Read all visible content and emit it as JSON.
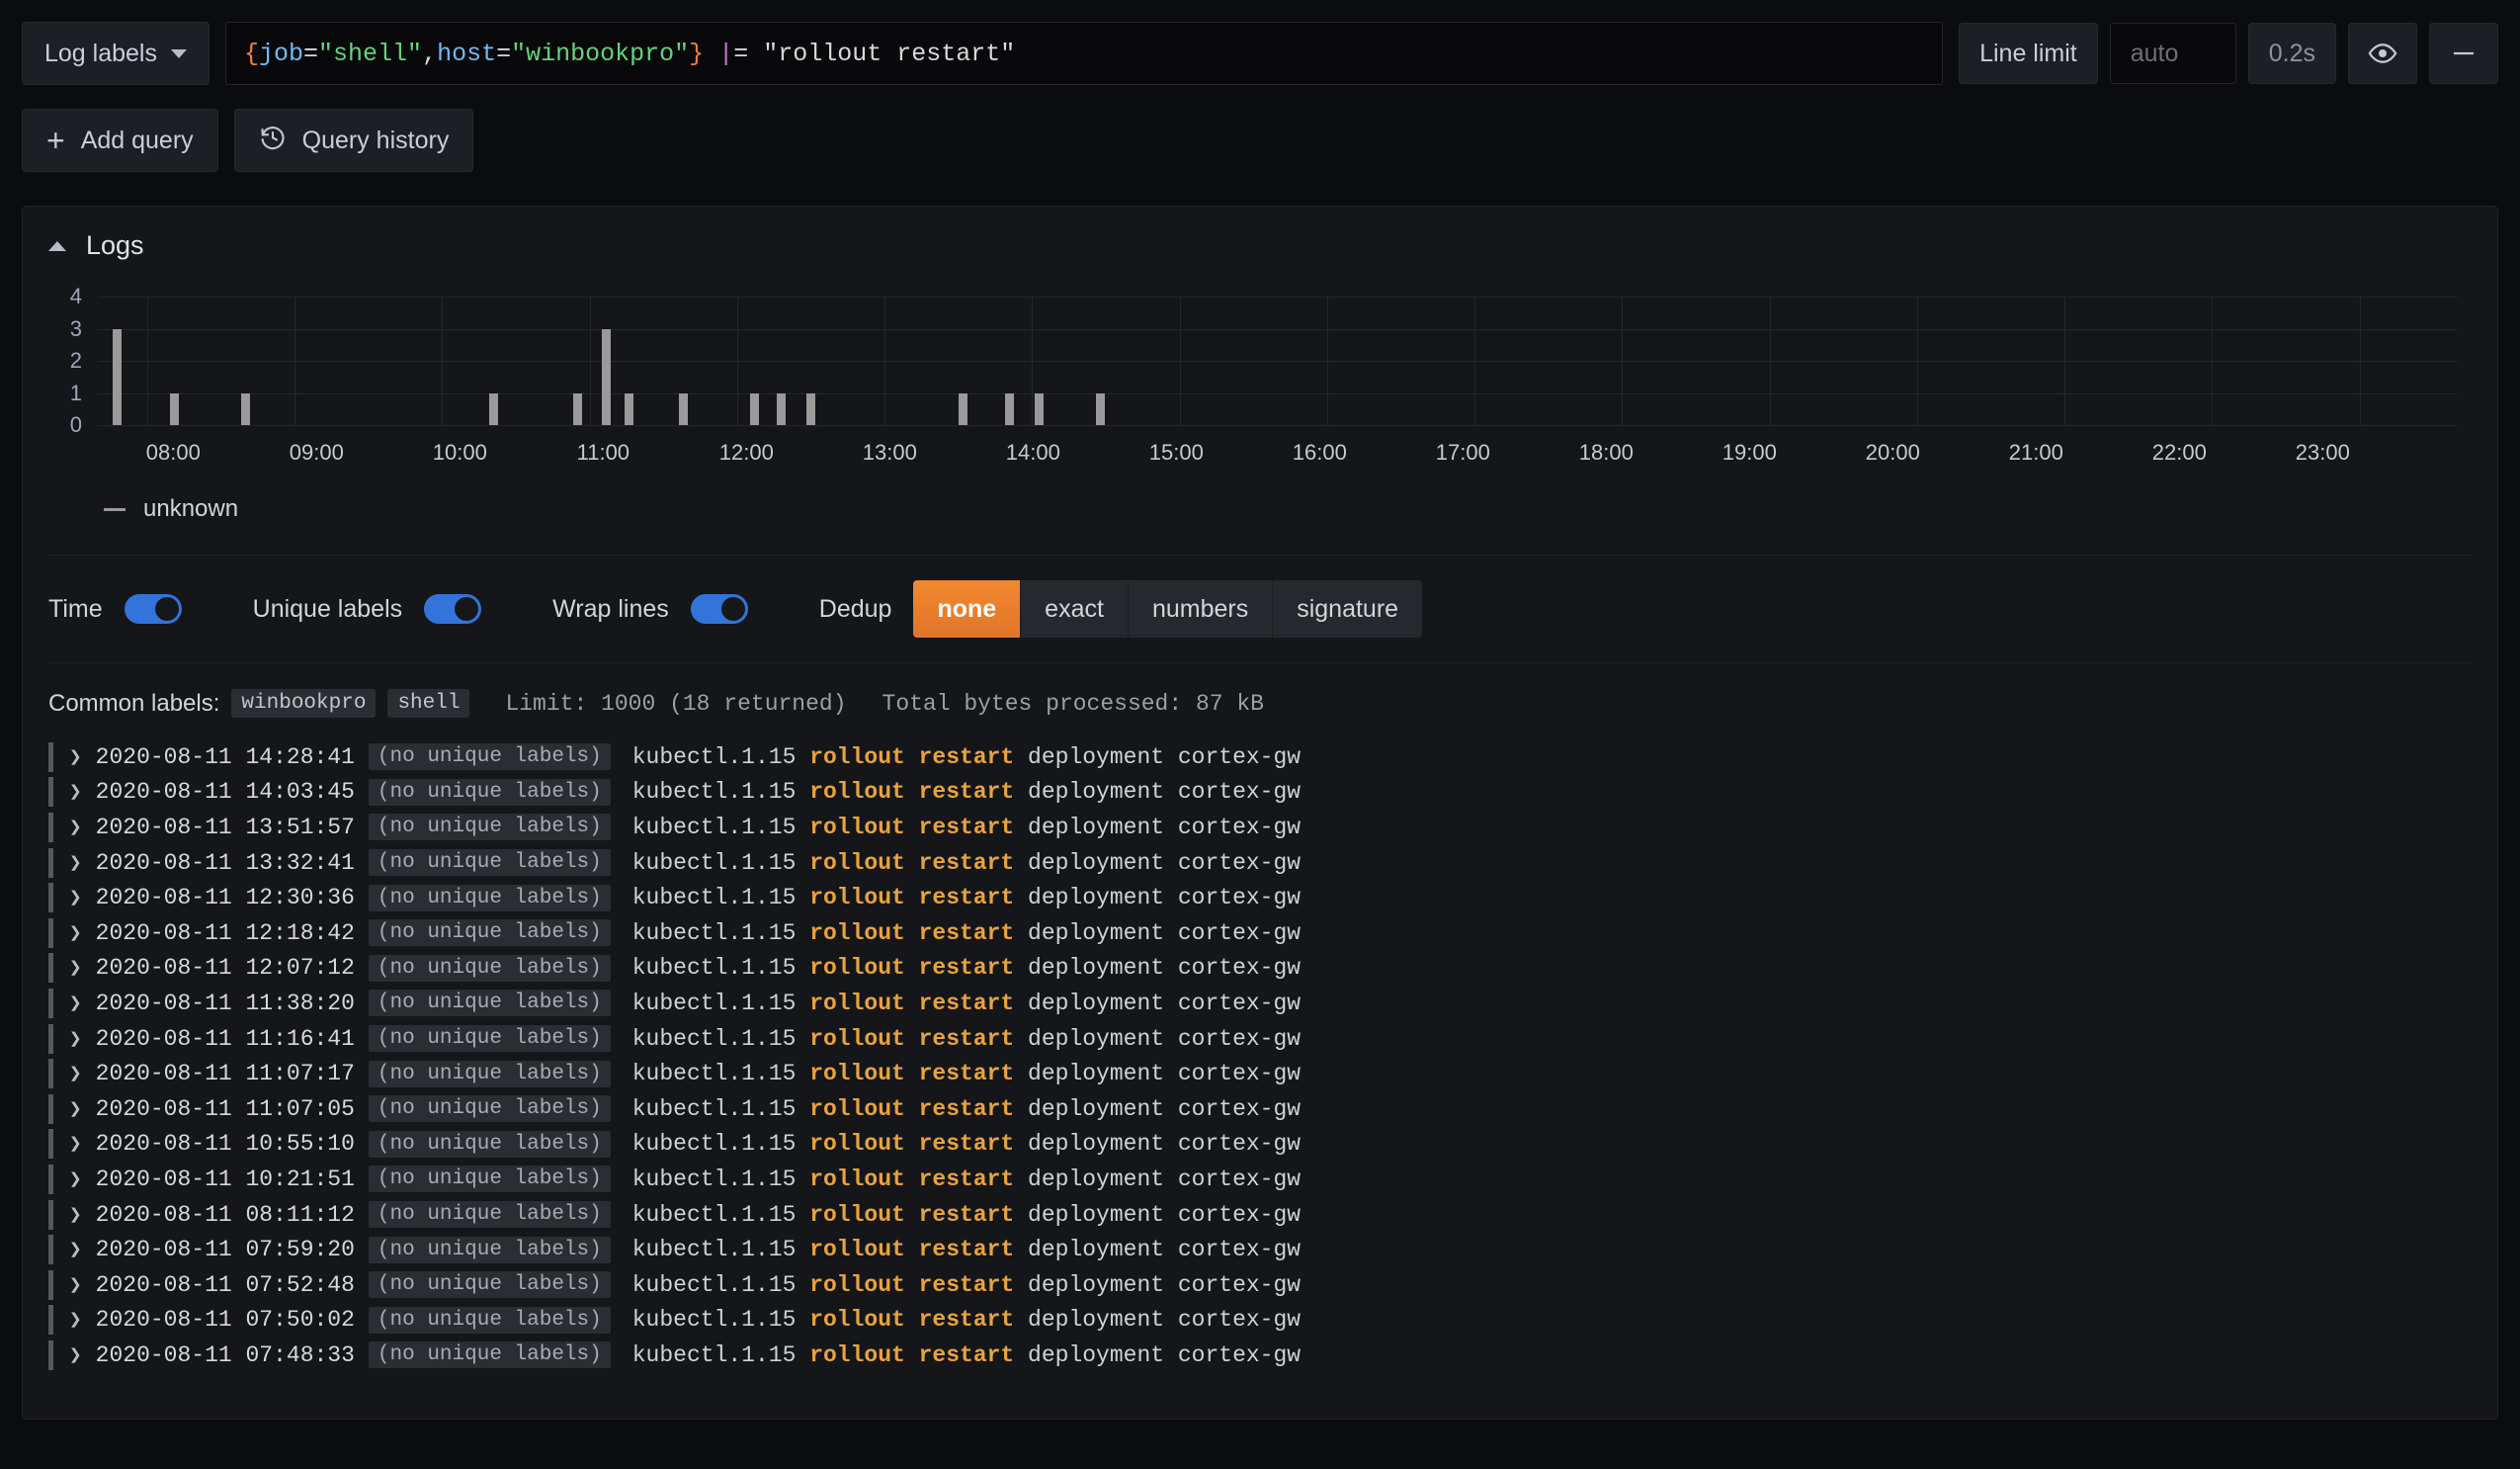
{
  "query": {
    "log_labels_button": "Log labels",
    "expr_tokens": [
      {
        "t": "{",
        "c": "brace"
      },
      {
        "t": "job",
        "c": "label"
      },
      {
        "t": "=",
        "c": "eq"
      },
      {
        "t": "\"shell\"",
        "c": "str"
      },
      {
        "t": ",",
        "c": "eq"
      },
      {
        "t": "host",
        "c": "label"
      },
      {
        "t": "=",
        "c": "eq"
      },
      {
        "t": "\"winbookpro\"",
        "c": "str"
      },
      {
        "t": "}",
        "c": "brace"
      },
      {
        "t": " ",
        "c": "plain"
      },
      {
        "t": "|",
        "c": "pipe"
      },
      {
        "t": "= ",
        "c": "plain"
      },
      {
        "t": "\"rollout restart\"",
        "c": "plain"
      }
    ],
    "expr_plain": "{job=\"shell\",host=\"winbookpro\"} |= \"rollout restart\"",
    "line_limit_label": "Line limit",
    "line_limit_placeholder": "auto",
    "line_limit_value": "",
    "duration": "0.2s",
    "eye_icon": "eye-icon",
    "remove_icon": "minus-icon"
  },
  "actions": {
    "add_query": "Add query",
    "query_history": "Query history",
    "add_icon": "plus-icon",
    "history_icon": "history-icon"
  },
  "panel": {
    "title": "Logs",
    "collapse_icon": "chevron-up-icon"
  },
  "chart_data": {
    "type": "bar",
    "title": "Logs",
    "xlabel": "",
    "ylabel": "",
    "ylim": [
      0,
      4
    ],
    "yticks": [
      0,
      1,
      2,
      3,
      4
    ],
    "grid": true,
    "legend": [
      "unknown"
    ],
    "legend_position": "bottom-left",
    "xticks": [
      "08:00",
      "09:00",
      "10:00",
      "11:00",
      "12:00",
      "13:00",
      "14:00",
      "15:00",
      "16:00",
      "17:00",
      "18:00",
      "19:00",
      "20:00",
      "21:00",
      "22:00",
      "23:00"
    ],
    "xlim": [
      "07:40",
      "23:40"
    ],
    "series": [
      {
        "name": "unknown",
        "color": "#9a9a9a",
        "points": [
          {
            "x": "07:48",
            "y": 3
          },
          {
            "x": "08:11",
            "y": 1
          },
          {
            "x": "08:40",
            "y": 1
          },
          {
            "x": "10:21",
            "y": 1
          },
          {
            "x": "10:55",
            "y": 1
          },
          {
            "x": "11:07",
            "y": 3
          },
          {
            "x": "11:16",
            "y": 1
          },
          {
            "x": "11:38",
            "y": 1
          },
          {
            "x": "12:07",
            "y": 1
          },
          {
            "x": "12:18",
            "y": 1
          },
          {
            "x": "12:30",
            "y": 1
          },
          {
            "x": "13:32",
            "y": 1
          },
          {
            "x": "13:51",
            "y": 1
          },
          {
            "x": "14:03",
            "y": 1
          },
          {
            "x": "14:28",
            "y": 1
          }
        ]
      }
    ]
  },
  "options": {
    "time_label": "Time",
    "time_on": true,
    "unique_labels_label": "Unique labels",
    "unique_labels_on": true,
    "wrap_lines_label": "Wrap lines",
    "wrap_lines_on": true,
    "dedup_label": "Dedup",
    "dedup_options": [
      "none",
      "exact",
      "numbers",
      "signature"
    ],
    "dedup_selected": "none",
    "accent_color": "#e8833a",
    "toggle_color": "#3274d9"
  },
  "meta": {
    "common_labels_label": "Common labels:",
    "common_labels": [
      "winbookpro",
      "shell"
    ],
    "limit_text": "Limit: 1000 (18 returned)",
    "bytes_text": "Total bytes processed: 87 kB"
  },
  "logs": {
    "expand_icon": "chevron-right-icon",
    "no_unique_labels": "(no unique labels)",
    "rows": [
      {
        "time": "2020-08-11 14:28:41",
        "pre": "kubectl.1.15 ",
        "hl": "rollout restart",
        "post": " deployment cortex-gw"
      },
      {
        "time": "2020-08-11 14:03:45",
        "pre": "kubectl.1.15 ",
        "hl": "rollout restart",
        "post": " deployment cortex-gw"
      },
      {
        "time": "2020-08-11 13:51:57",
        "pre": "kubectl.1.15 ",
        "hl": "rollout restart",
        "post": " deployment cortex-gw"
      },
      {
        "time": "2020-08-11 13:32:41",
        "pre": "kubectl.1.15 ",
        "hl": "rollout restart",
        "post": " deployment cortex-gw"
      },
      {
        "time": "2020-08-11 12:30:36",
        "pre": "kubectl.1.15 ",
        "hl": "rollout restart",
        "post": " deployment cortex-gw"
      },
      {
        "time": "2020-08-11 12:18:42",
        "pre": "kubectl.1.15 ",
        "hl": "rollout restart",
        "post": " deployment cortex-gw"
      },
      {
        "time": "2020-08-11 12:07:12",
        "pre": "kubectl.1.15 ",
        "hl": "rollout restart",
        "post": " deployment cortex-gw"
      },
      {
        "time": "2020-08-11 11:38:20",
        "pre": "kubectl.1.15 ",
        "hl": "rollout restart",
        "post": " deployment cortex-gw"
      },
      {
        "time": "2020-08-11 11:16:41",
        "pre": "kubectl.1.15 ",
        "hl": "rollout restart",
        "post": " deployment cortex-gw"
      },
      {
        "time": "2020-08-11 11:07:17",
        "pre": "kubectl.1.15 ",
        "hl": "rollout restart",
        "post": " deployment cortex-gw"
      },
      {
        "time": "2020-08-11 11:07:05",
        "pre": "kubectl.1.15 ",
        "hl": "rollout restart",
        "post": " deployment cortex-gw"
      },
      {
        "time": "2020-08-11 10:55:10",
        "pre": "kubectl.1.15 ",
        "hl": "rollout restart",
        "post": " deployment cortex-gw"
      },
      {
        "time": "2020-08-11 10:21:51",
        "pre": "kubectl.1.15 ",
        "hl": "rollout restart",
        "post": " deployment cortex-gw"
      },
      {
        "time": "2020-08-11 08:11:12",
        "pre": "kubectl.1.15 ",
        "hl": "rollout restart",
        "post": " deployment cortex-gw"
      },
      {
        "time": "2020-08-11 07:59:20",
        "pre": "kubectl.1.15 ",
        "hl": "rollout restart",
        "post": " deployment cortex-gw"
      },
      {
        "time": "2020-08-11 07:52:48",
        "pre": "kubectl.1.15 ",
        "hl": "rollout restart",
        "post": " deployment cortex-gw"
      },
      {
        "time": "2020-08-11 07:50:02",
        "pre": "kubectl.1.15 ",
        "hl": "rollout restart",
        "post": " deployment cortex-gw"
      },
      {
        "time": "2020-08-11 07:48:33",
        "pre": "kubectl.1.15 ",
        "hl": "rollout restart",
        "post": " deployment cortex-gw"
      }
    ]
  }
}
